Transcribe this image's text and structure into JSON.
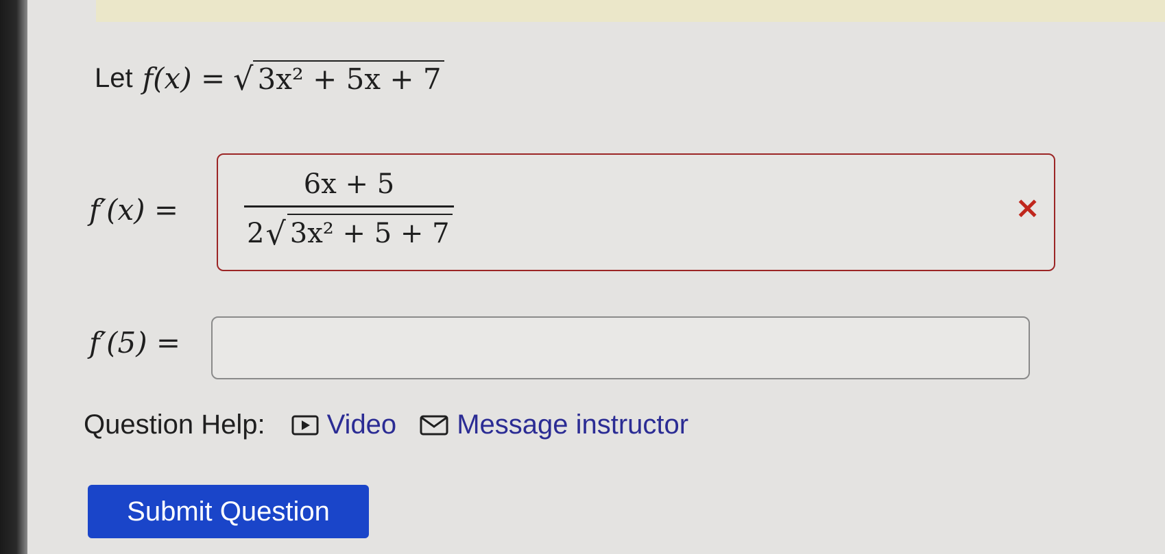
{
  "question": {
    "definition": {
      "let_word": "Let",
      "lhs": "f(x) =",
      "radicand": "3x² + 5x + 7"
    },
    "derivative": {
      "label": "f′(x) =",
      "answer": {
        "numerator": "6x + 5",
        "denominator_coef": "2",
        "denominator_radicand": "3x² + 5 + 7"
      },
      "status_mark": "×"
    },
    "evaluation": {
      "label": "f′(5) =",
      "value": "",
      "placeholder": ""
    }
  },
  "help": {
    "label": "Question Help:",
    "links": [
      {
        "label": "Video",
        "icon": "video-icon"
      },
      {
        "label": "Message instructor",
        "icon": "mail-icon"
      }
    ]
  },
  "submit_label": "Submit Question",
  "colors": {
    "error": "#c0271d",
    "link": "#2b2c94",
    "button": "#1a45c9"
  }
}
